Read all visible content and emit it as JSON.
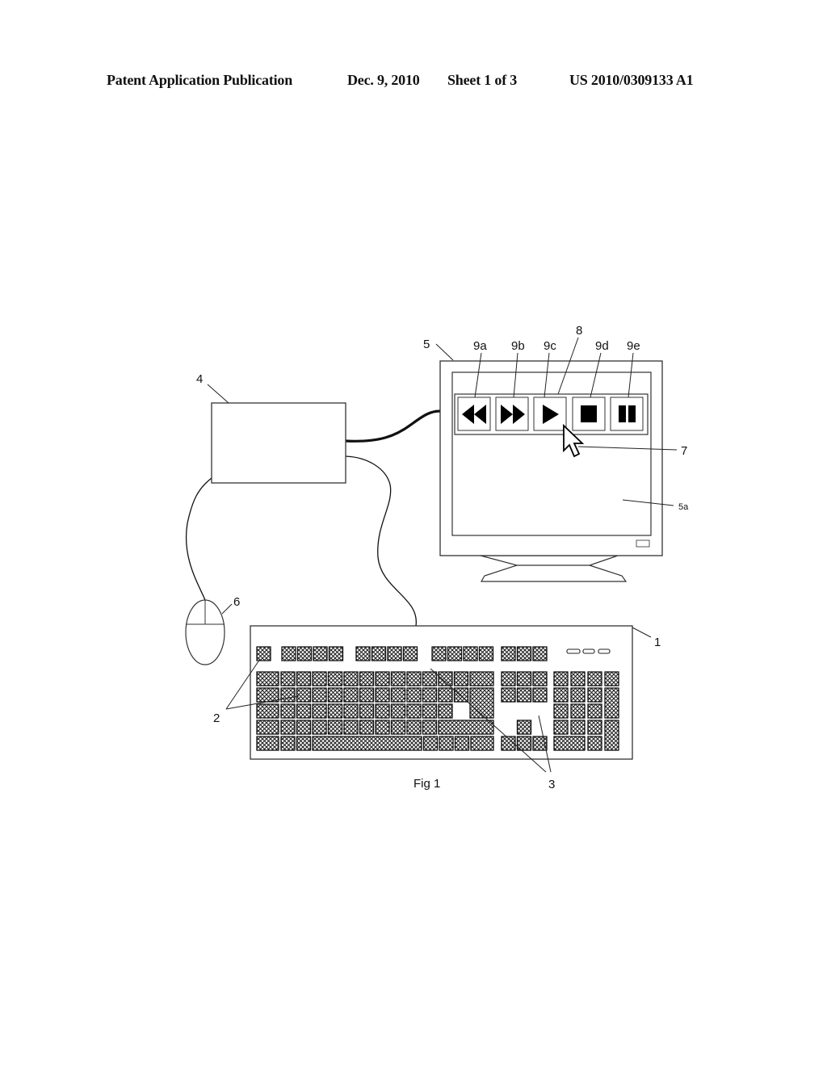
{
  "header": {
    "publication_type": "Patent Application Publication",
    "date": "Dec. 9, 2010",
    "sheet": "Sheet 1 of 3",
    "publication_number": "US 2010/0309133 A1"
  },
  "figure": {
    "caption": "Fig 1",
    "reference_labels": {
      "keyboard": "1",
      "keys": "2",
      "control_keys": "3",
      "computer": "4",
      "monitor": "5",
      "screen": "5a",
      "mouse": "6",
      "cursor": "7",
      "toolbar": "8",
      "rewind_button": "9a",
      "fast_forward_button": "9b",
      "play_button": "9c",
      "stop_button": "9d",
      "pause_button": "9e"
    },
    "toolbar_buttons": [
      {
        "id": "9a",
        "icon": "rewind-icon"
      },
      {
        "id": "9b",
        "icon": "fast-forward-icon"
      },
      {
        "id": "9c",
        "icon": "play-icon"
      },
      {
        "id": "9d",
        "icon": "stop-icon"
      },
      {
        "id": "9e",
        "icon": "pause-icon"
      }
    ]
  }
}
